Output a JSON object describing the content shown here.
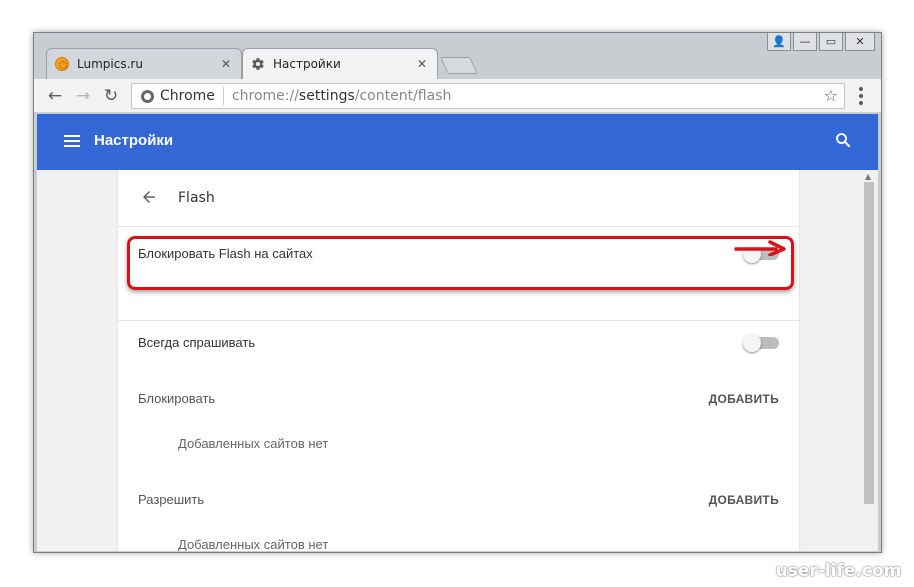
{
  "tabs": [
    {
      "title": "Lumpics.ru",
      "close_glyph": "✕",
      "icon": "lumpics-favicon"
    },
    {
      "title": "Настройки",
      "close_glyph": "✕",
      "icon": "gear-icon"
    }
  ],
  "window_controls": {
    "user": "👤",
    "minimize": "—",
    "maximize": "▭",
    "close": "✕"
  },
  "toolbar": {
    "back": "←",
    "forward": "→",
    "reload": "↻",
    "omnibox_label": "Chrome",
    "url_scheme": "chrome://",
    "url_host": "settings",
    "url_path": "/content/flash",
    "star": "☆"
  },
  "header": {
    "title": "Настройки"
  },
  "page": {
    "heading": "Flash",
    "block_flash_label": "Блокировать Flash на сайтах",
    "always_ask_label": "Всегда спрашивать",
    "block_section": "Блокировать",
    "block_add": "ДОБАВИТЬ",
    "block_empty": "Добавленных сайтов нет",
    "allow_section": "Разрешить",
    "allow_add": "ДОБАВИТЬ",
    "allow_empty": "Добавленных сайтов нет"
  },
  "toggles": {
    "block_flash": false,
    "always_ask": false
  },
  "watermark": "user-life.com",
  "colors": {
    "header_bg": "#3367d6",
    "highlight": "#d6131a"
  }
}
